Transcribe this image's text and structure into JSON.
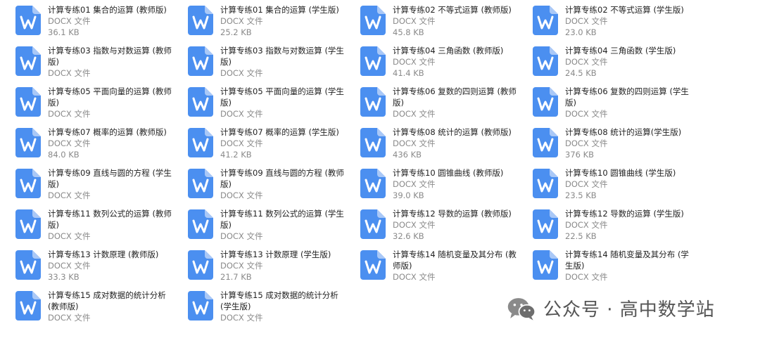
{
  "files": [
    {
      "name": "计算专练01 集合的运算 (教师版)",
      "type": "DOCX 文件",
      "size": "36.1 KB"
    },
    {
      "name": "计算专练01 集合的运算 (学生版)",
      "type": "DOCX 文件",
      "size": "25.2 KB"
    },
    {
      "name": "计算专练02 不等式运算 (教师版)",
      "type": "DOCX 文件",
      "size": "45.8 KB"
    },
    {
      "name": "计算专练02 不等式运算 (学生版)",
      "type": "DOCX 文件",
      "size": "23.0 KB"
    },
    {
      "name": "计算专练03 指数与对数运算 (教师版)",
      "type": "DOCX 文件",
      "size": ""
    },
    {
      "name": "计算专练03 指数与对数运算 (学生版)",
      "type": "DOCX 文件",
      "size": ""
    },
    {
      "name": "计算专练04 三角函数 (教师版)",
      "type": "DOCX 文件",
      "size": "41.4 KB"
    },
    {
      "name": "计算专练04 三角函数 (学生版)",
      "type": "DOCX 文件",
      "size": "24.5 KB"
    },
    {
      "name": "计算专练05 平面向量的运算 (教师版)",
      "type": "DOCX 文件",
      "size": ""
    },
    {
      "name": "计算专练05 平面向量的运算 (学生版)",
      "type": "DOCX 文件",
      "size": ""
    },
    {
      "name": "计算专练06 复数的四则运算 (教师版)",
      "type": "DOCX 文件",
      "size": ""
    },
    {
      "name": "计算专练06 复数的四则运算 (学生版)",
      "type": "DOCX 文件",
      "size": ""
    },
    {
      "name": "计算专练07 概率的运算 (教师版)",
      "type": "DOCX 文件",
      "size": "84.0 KB"
    },
    {
      "name": "计算专练07 概率的运算 (学生版)",
      "type": "DOCX 文件",
      "size": "41.2 KB"
    },
    {
      "name": "计算专练08 统计的运算 (教师版)",
      "type": "DOCX 文件",
      "size": "436 KB"
    },
    {
      "name": "计算专练08 统计的运算(学生版)",
      "type": "DOCX 文件",
      "size": "376 KB"
    },
    {
      "name": "计算专练09 直线与圆的方程 (学生版)",
      "type": "DOCX 文件",
      "size": ""
    },
    {
      "name": "计算专练09 直线与圆的方程 (教师版)",
      "type": "DOCX 文件",
      "size": ""
    },
    {
      "name": "计算专练10 圆锥曲线 (教师版)",
      "type": "DOCX 文件",
      "size": "39.0 KB"
    },
    {
      "name": "计算专练10 圆锥曲线 (学生版)",
      "type": "DOCX 文件",
      "size": "23.5 KB"
    },
    {
      "name": "计算专练11 数列公式的运算 (教师版)",
      "type": "DOCX 文件",
      "size": ""
    },
    {
      "name": "计算专练11 数列公式的运算 (学生版)",
      "type": "DOCX 文件",
      "size": ""
    },
    {
      "name": "计算专练12 导数的运算 (教师版)",
      "type": "DOCX 文件",
      "size": "32.6 KB"
    },
    {
      "name": "计算专练12 导数的运算 (学生版)",
      "type": "DOCX 文件",
      "size": "22.5 KB"
    },
    {
      "name": "计算专练13 计数原理 (教师版)",
      "type": "DOCX 文件",
      "size": "33.3 KB"
    },
    {
      "name": "计算专练13 计数原理 (学生版)",
      "type": "DOCX 文件",
      "size": "21.7 KB"
    },
    {
      "name": "计算专练14 随机变量及其分布 (教师版)",
      "type": "DOCX 文件",
      "size": ""
    },
    {
      "name": "计算专练14 随机变量及其分布 (学生版)",
      "type": "DOCX 文件",
      "size": ""
    },
    {
      "name": "计算专练15 成对数据的统计分析 (教师版)",
      "type": "DOCX 文件",
      "size": ""
    },
    {
      "name": "计算专练15 成对数据的统计分析 (学生版)",
      "type": "DOCX 文件",
      "size": ""
    }
  ],
  "watermark": {
    "text": "公众号 · 高中数学站",
    "icon": "wechat-icon"
  },
  "colors": {
    "icon_blue": "#4b8ff0",
    "text": "#222222",
    "meta": "#8a8a8a"
  }
}
